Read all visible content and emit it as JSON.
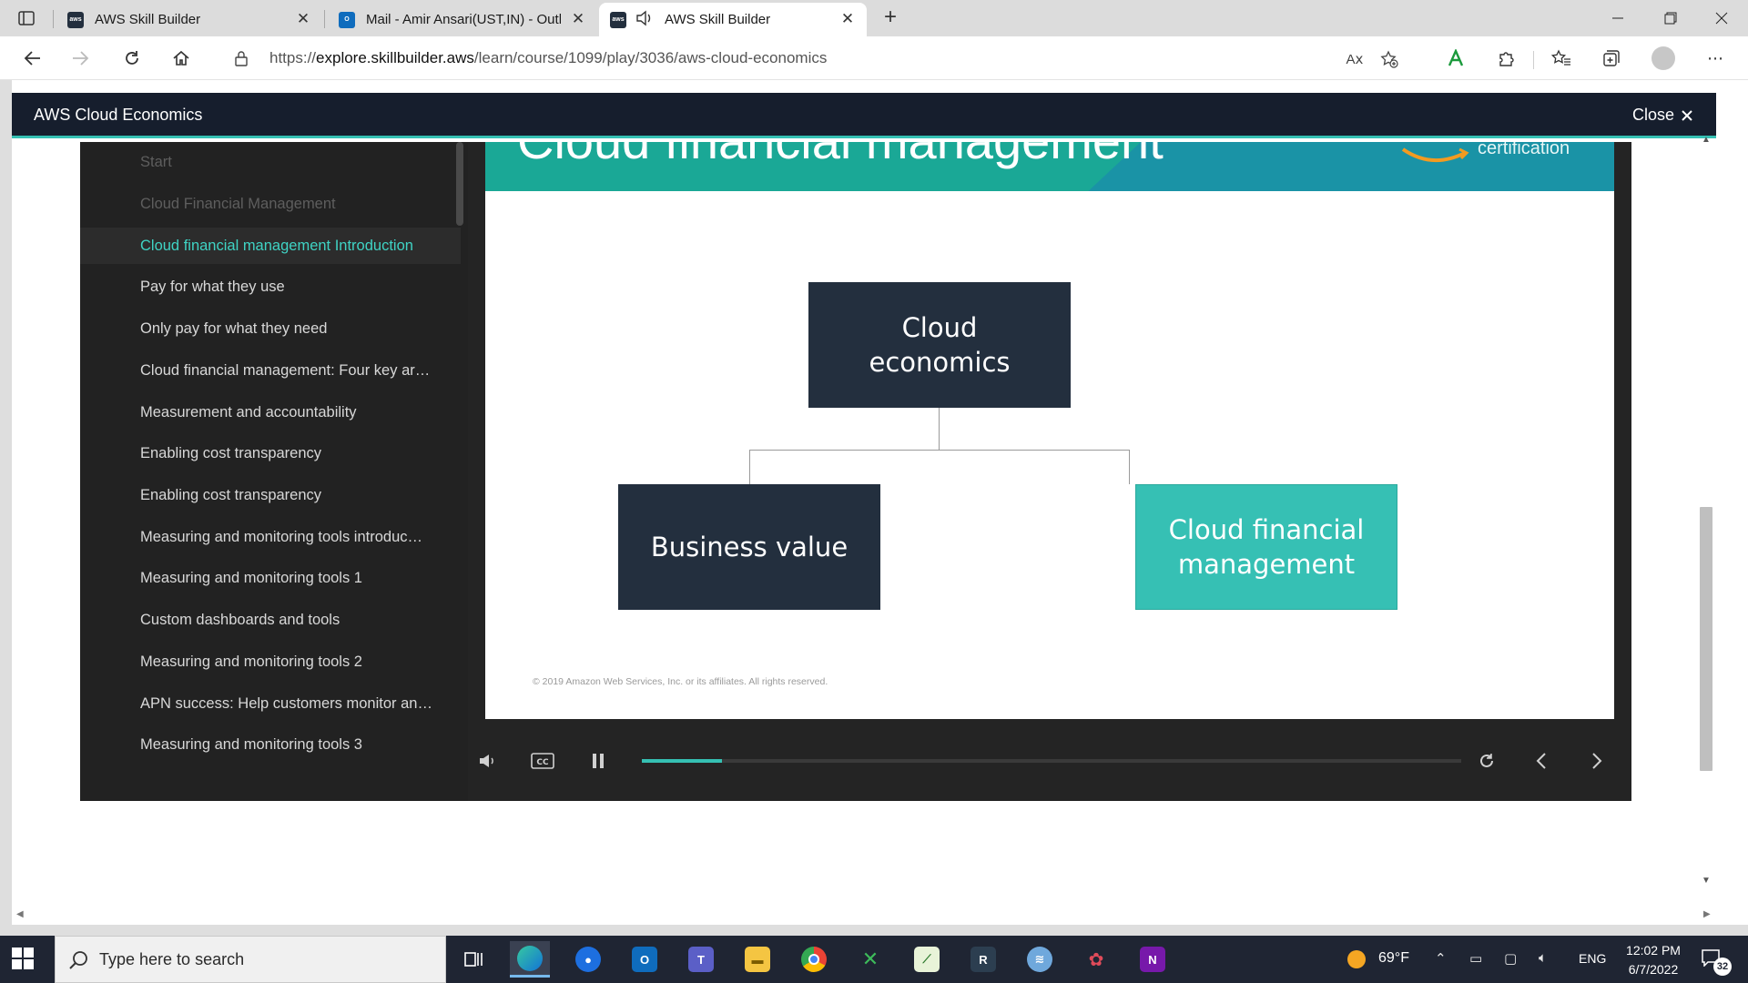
{
  "browser": {
    "tabs": [
      {
        "title": "AWS Skill Builder",
        "favicon": "aws-favicon",
        "active": false
      },
      {
        "title": "Mail - Amir Ansari(UST,IN) - Outl",
        "favicon": "outlook-favicon",
        "active": false
      },
      {
        "title": "AWS Skill Builder",
        "favicon": "aws-favicon",
        "active": true,
        "audio": true
      }
    ],
    "url_prefix": "https://",
    "url_host": "explore.skillbuilder.aws",
    "url_path": "/learn/course/1099/play/3036/aws-cloud-economics",
    "read_aloud_icon": "Aⅹ"
  },
  "course": {
    "title": "AWS Cloud Economics",
    "close_label": "Close"
  },
  "outline": {
    "items": [
      {
        "label": "Start",
        "state": "dim"
      },
      {
        "label": "Cloud Financial Management",
        "state": "dim"
      },
      {
        "label": "Cloud financial management Introduction",
        "state": "active"
      },
      {
        "label": "Pay for what they use",
        "state": "normal"
      },
      {
        "label": "Only pay for what they need",
        "state": "normal"
      },
      {
        "label": "Cloud financial management: Four key ar…",
        "state": "normal"
      },
      {
        "label": "Measurement and accountability",
        "state": "normal"
      },
      {
        "label": "Enabling cost transparency",
        "state": "normal"
      },
      {
        "label": "Enabling cost transparency",
        "state": "normal"
      },
      {
        "label": "Measuring and monitoring tools introduc…",
        "state": "normal"
      },
      {
        "label": "Measuring and monitoring tools 1",
        "state": "normal"
      },
      {
        "label": "Custom dashboards and tools",
        "state": "normal"
      },
      {
        "label": "Measuring and monitoring tools 2",
        "state": "normal"
      },
      {
        "label": "APN success: Help customers monitor an…",
        "state": "normal"
      },
      {
        "label": "Measuring and monitoring tools 3",
        "state": "normal"
      }
    ]
  },
  "slide": {
    "heading": "Cloud financial management",
    "badge_text": "certification",
    "root_node": {
      "line1": "Cloud",
      "line2": "economics"
    },
    "left_node": "Business value",
    "right_node": {
      "line1": "Cloud financial",
      "line2": "management"
    },
    "copyright": "© 2019 Amazon Web Services, Inc. or its affiliates. All rights reserved.",
    "colors": {
      "navy": "#232f3e",
      "teal": "#36c0b4",
      "banner": "#1a93a6"
    }
  },
  "player": {
    "progress": 0.098,
    "playing": true
  },
  "taskbar": {
    "search_placeholder": "Type here to search",
    "weather_temp": "69°F",
    "language": "ENG",
    "time": "12:02 PM",
    "date": "6/7/2022",
    "notification_count": "32",
    "apps": [
      "task-view",
      "edge",
      "maps",
      "outlook",
      "teams",
      "file-explorer",
      "chrome",
      "app-x",
      "notepad-chart",
      "r-app",
      "network-app",
      "paint",
      "onenote"
    ]
  }
}
